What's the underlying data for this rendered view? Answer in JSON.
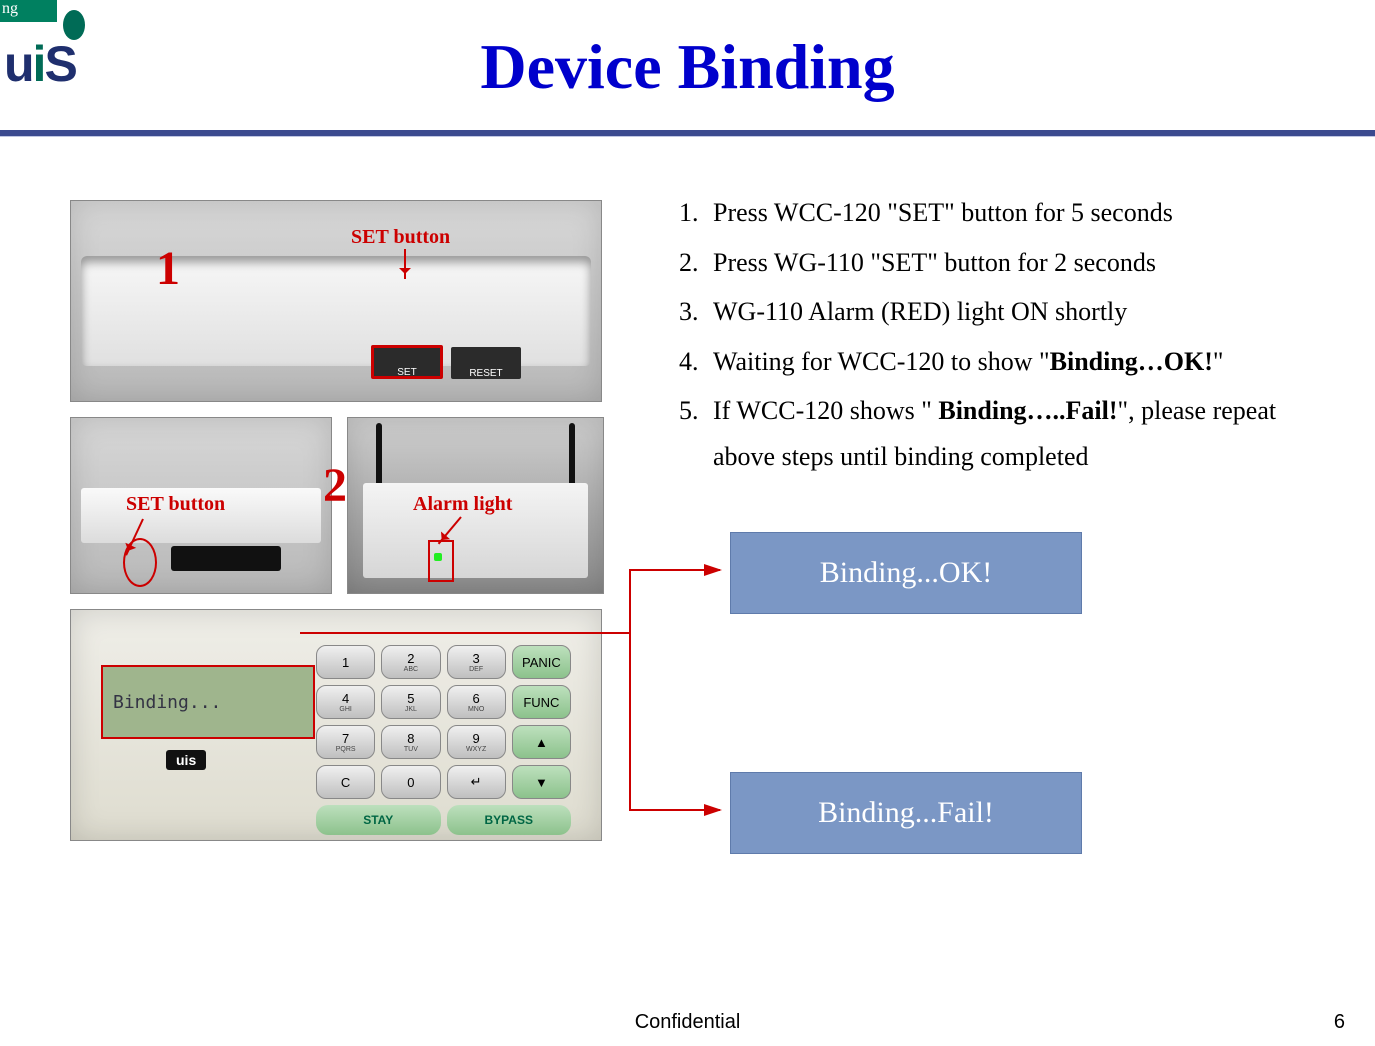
{
  "topstrip": "ng",
  "logo_text_parts": {
    "u": "u",
    "i": "i",
    "s": "S"
  },
  "title": "Device Binding",
  "labels": {
    "set_button": "SET button",
    "alarm_light": "Alarm light",
    "num1": "1",
    "num2": "2",
    "btn_set": "SET",
    "btn_reset": "RESET",
    "lcd": "Binding...",
    "brand": "uis"
  },
  "keypad": {
    "r1": [
      {
        "m": "1",
        "s": ""
      },
      {
        "m": "2",
        "s": "ABC"
      },
      {
        "m": "3",
        "s": "DEF"
      },
      {
        "m": "PANIC",
        "s": ""
      }
    ],
    "r2": [
      {
        "m": "4",
        "s": "GHI"
      },
      {
        "m": "5",
        "s": "JKL"
      },
      {
        "m": "6",
        "s": "MNO"
      },
      {
        "m": "FUNC",
        "s": ""
      }
    ],
    "r3": [
      {
        "m": "7",
        "s": "PQRS"
      },
      {
        "m": "8",
        "s": "TUV"
      },
      {
        "m": "9",
        "s": "WXYZ"
      },
      {
        "m": "▲",
        "s": ""
      }
    ],
    "r4": [
      {
        "m": "C",
        "s": ""
      },
      {
        "m": "0",
        "s": ""
      },
      {
        "m": "↵",
        "s": ""
      },
      {
        "m": "▼",
        "s": ""
      }
    ],
    "bottom": [
      "STAY",
      "BYPASS"
    ]
  },
  "steps": [
    {
      "pre": "Press WCC-120 \"SET\" button for 5 seconds",
      "bold": "",
      "post": ""
    },
    {
      "pre": "Press WG-110 \"SET\" button for 2 seconds",
      "bold": "",
      "post": ""
    },
    {
      "pre": "WG-110 Alarm (RED) light ON shortly",
      "bold": "",
      "post": ""
    },
    {
      "pre": "Waiting for WCC-120 to show \"",
      "bold": "Binding…OK!",
      "post": "\""
    },
    {
      "pre": "If WCC-120 shows \" ",
      "bold": "Binding…..Fail!",
      "post": "\", please repeat above steps until binding completed"
    }
  ],
  "result_ok": "Binding...OK!",
  "result_fail": "Binding...Fail!",
  "footer_center": "Confidential",
  "footer_page": "6"
}
